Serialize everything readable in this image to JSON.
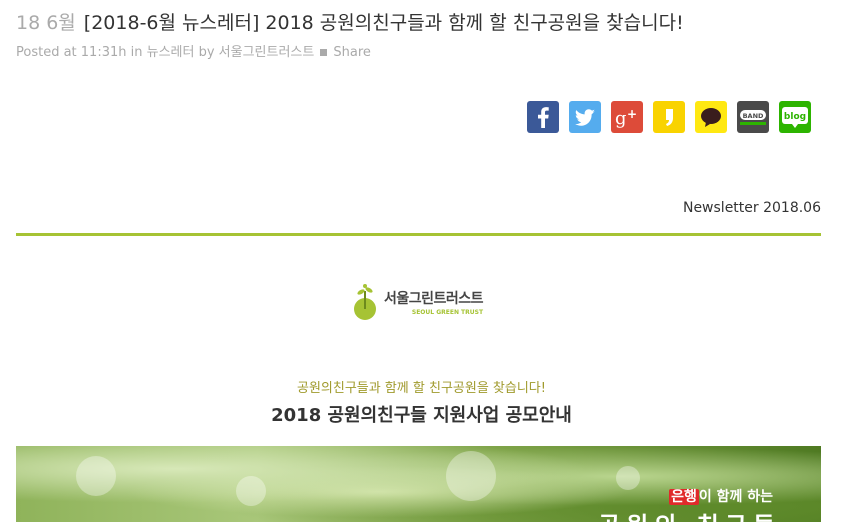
{
  "post": {
    "date": "18 6월",
    "title": "[2018-6월 뉴스레터] 2018 공원의친구들과 함께 할 친구공원을 찾습니다!",
    "meta_posted": "Posted at 11:31h in ",
    "meta_category": "뉴스레터",
    "meta_by": " by ",
    "meta_author": "서울그린트러스트",
    "meta_share": "Share"
  },
  "share_buttons": [
    {
      "name": "facebook",
      "icon": "facebook-icon",
      "color": "#3b5998"
    },
    {
      "name": "twitter",
      "icon": "twitter-icon",
      "color": "#55acee"
    },
    {
      "name": "google-plus",
      "icon": "google-plus-icon",
      "color": "#dd4b39"
    },
    {
      "name": "kakaostory",
      "icon": "kakaostory-icon",
      "color": "#f9d300"
    },
    {
      "name": "kakaotalk",
      "icon": "kakaotalk-icon",
      "color": "#ffe812"
    },
    {
      "name": "band",
      "icon": "band-icon",
      "label": "BAND",
      "color": "#4a4a4a"
    },
    {
      "name": "blog",
      "icon": "naver-blog-icon",
      "label": "blog",
      "color": "#2db400"
    }
  ],
  "newsletter": {
    "issue_label": "Newsletter 2018.06",
    "logo_ko": "서울그린트러스트",
    "logo_en": "SEOUL GREEN TRUST",
    "subtitle": "공원의친구들과 함께 할 친구공원을 찾습니다!",
    "heading": "2018 공원의친구들 지원사업 공모안내",
    "banner_caption_highlight": "은행",
    "banner_caption_rest": "이 함께 하는",
    "banner_big": "공원의 친구들"
  },
  "colors": {
    "accent_green": "#a6c334",
    "subtitle_olive": "#a09a2c",
    "meta_gray": "#aaaaaa"
  }
}
